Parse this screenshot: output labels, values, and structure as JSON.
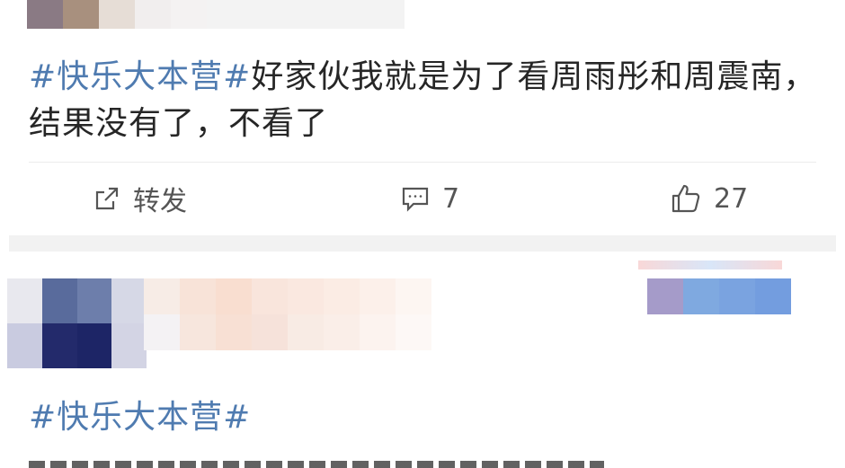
{
  "post1": {
    "text_hashtag": "#快乐大本营#",
    "text_line1_rest": "好家伙我就是为了看周雨彤和周震南，",
    "text_line2": "结果没有了，不看了",
    "actions": {
      "repost_label": "转发",
      "comment_count": "7",
      "like_count": "27"
    }
  },
  "post2": {
    "text_hashtag": "#快乐大本营#"
  },
  "icons": {
    "repost": "share-box-icon",
    "comment": "comment-bubble-icon",
    "like": "thumbs-up-icon"
  },
  "colors": {
    "hashtag": "#4f7bb0",
    "text": "#262626",
    "action": "#555555"
  }
}
